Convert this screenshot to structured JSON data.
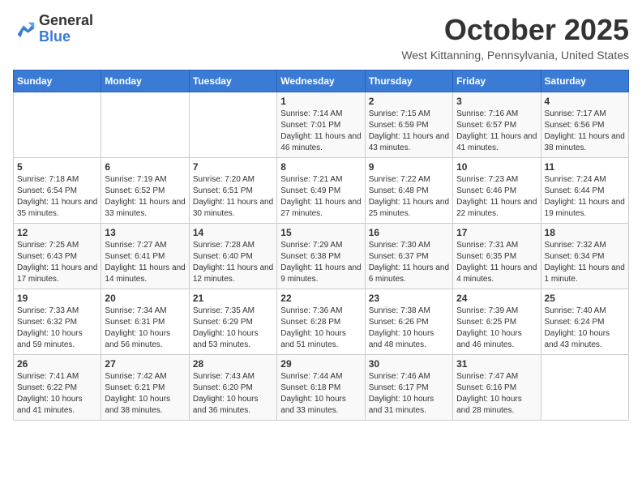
{
  "logo": {
    "line1": "General",
    "line2": "Blue"
  },
  "title": "October 2025",
  "location": "West Kittanning, Pennsylvania, United States",
  "days_of_week": [
    "Sunday",
    "Monday",
    "Tuesday",
    "Wednesday",
    "Thursday",
    "Friday",
    "Saturday"
  ],
  "weeks": [
    [
      {
        "day": "",
        "info": ""
      },
      {
        "day": "",
        "info": ""
      },
      {
        "day": "",
        "info": ""
      },
      {
        "day": "1",
        "info": "Sunrise: 7:14 AM\nSunset: 7:01 PM\nDaylight: 11 hours and 46 minutes."
      },
      {
        "day": "2",
        "info": "Sunrise: 7:15 AM\nSunset: 6:59 PM\nDaylight: 11 hours and 43 minutes."
      },
      {
        "day": "3",
        "info": "Sunrise: 7:16 AM\nSunset: 6:57 PM\nDaylight: 11 hours and 41 minutes."
      },
      {
        "day": "4",
        "info": "Sunrise: 7:17 AM\nSunset: 6:56 PM\nDaylight: 11 hours and 38 minutes."
      }
    ],
    [
      {
        "day": "5",
        "info": "Sunrise: 7:18 AM\nSunset: 6:54 PM\nDaylight: 11 hours and 35 minutes."
      },
      {
        "day": "6",
        "info": "Sunrise: 7:19 AM\nSunset: 6:52 PM\nDaylight: 11 hours and 33 minutes."
      },
      {
        "day": "7",
        "info": "Sunrise: 7:20 AM\nSunset: 6:51 PM\nDaylight: 11 hours and 30 minutes."
      },
      {
        "day": "8",
        "info": "Sunrise: 7:21 AM\nSunset: 6:49 PM\nDaylight: 11 hours and 27 minutes."
      },
      {
        "day": "9",
        "info": "Sunrise: 7:22 AM\nSunset: 6:48 PM\nDaylight: 11 hours and 25 minutes."
      },
      {
        "day": "10",
        "info": "Sunrise: 7:23 AM\nSunset: 6:46 PM\nDaylight: 11 hours and 22 minutes."
      },
      {
        "day": "11",
        "info": "Sunrise: 7:24 AM\nSunset: 6:44 PM\nDaylight: 11 hours and 19 minutes."
      }
    ],
    [
      {
        "day": "12",
        "info": "Sunrise: 7:25 AM\nSunset: 6:43 PM\nDaylight: 11 hours and 17 minutes."
      },
      {
        "day": "13",
        "info": "Sunrise: 7:27 AM\nSunset: 6:41 PM\nDaylight: 11 hours and 14 minutes."
      },
      {
        "day": "14",
        "info": "Sunrise: 7:28 AM\nSunset: 6:40 PM\nDaylight: 11 hours and 12 minutes."
      },
      {
        "day": "15",
        "info": "Sunrise: 7:29 AM\nSunset: 6:38 PM\nDaylight: 11 hours and 9 minutes."
      },
      {
        "day": "16",
        "info": "Sunrise: 7:30 AM\nSunset: 6:37 PM\nDaylight: 11 hours and 6 minutes."
      },
      {
        "day": "17",
        "info": "Sunrise: 7:31 AM\nSunset: 6:35 PM\nDaylight: 11 hours and 4 minutes."
      },
      {
        "day": "18",
        "info": "Sunrise: 7:32 AM\nSunset: 6:34 PM\nDaylight: 11 hours and 1 minute."
      }
    ],
    [
      {
        "day": "19",
        "info": "Sunrise: 7:33 AM\nSunset: 6:32 PM\nDaylight: 10 hours and 59 minutes."
      },
      {
        "day": "20",
        "info": "Sunrise: 7:34 AM\nSunset: 6:31 PM\nDaylight: 10 hours and 56 minutes."
      },
      {
        "day": "21",
        "info": "Sunrise: 7:35 AM\nSunset: 6:29 PM\nDaylight: 10 hours and 53 minutes."
      },
      {
        "day": "22",
        "info": "Sunrise: 7:36 AM\nSunset: 6:28 PM\nDaylight: 10 hours and 51 minutes."
      },
      {
        "day": "23",
        "info": "Sunrise: 7:38 AM\nSunset: 6:26 PM\nDaylight: 10 hours and 48 minutes."
      },
      {
        "day": "24",
        "info": "Sunrise: 7:39 AM\nSunset: 6:25 PM\nDaylight: 10 hours and 46 minutes."
      },
      {
        "day": "25",
        "info": "Sunrise: 7:40 AM\nSunset: 6:24 PM\nDaylight: 10 hours and 43 minutes."
      }
    ],
    [
      {
        "day": "26",
        "info": "Sunrise: 7:41 AM\nSunset: 6:22 PM\nDaylight: 10 hours and 41 minutes."
      },
      {
        "day": "27",
        "info": "Sunrise: 7:42 AM\nSunset: 6:21 PM\nDaylight: 10 hours and 38 minutes."
      },
      {
        "day": "28",
        "info": "Sunrise: 7:43 AM\nSunset: 6:20 PM\nDaylight: 10 hours and 36 minutes."
      },
      {
        "day": "29",
        "info": "Sunrise: 7:44 AM\nSunset: 6:18 PM\nDaylight: 10 hours and 33 minutes."
      },
      {
        "day": "30",
        "info": "Sunrise: 7:46 AM\nSunset: 6:17 PM\nDaylight: 10 hours and 31 minutes."
      },
      {
        "day": "31",
        "info": "Sunrise: 7:47 AM\nSunset: 6:16 PM\nDaylight: 10 hours and 28 minutes."
      },
      {
        "day": "",
        "info": ""
      }
    ]
  ]
}
